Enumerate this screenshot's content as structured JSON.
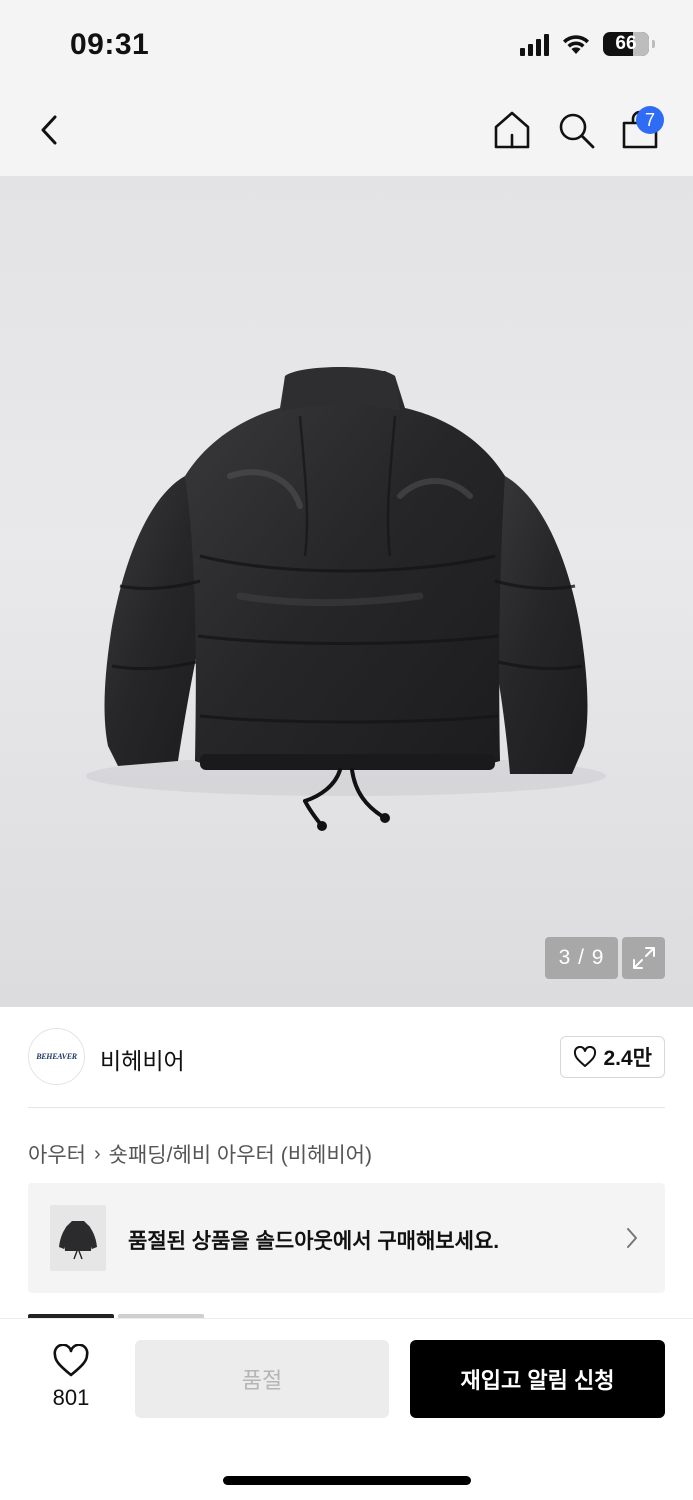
{
  "status_bar": {
    "time": "09:31",
    "battery_level": "66",
    "icons": [
      "cellular-signal-icon",
      "wifi-icon",
      "battery-icon"
    ]
  },
  "nav": {
    "icons": [
      "back-chevron-icon",
      "home-icon",
      "search-icon",
      "shopping-bag-icon"
    ],
    "cart_count": "7"
  },
  "product_image": {
    "counter": "3 / 9",
    "expand_icon": "expand-arrows-icon"
  },
  "brand": {
    "logo_text": "BEHEAVER",
    "name": "비헤비어",
    "like_count": "2.4만"
  },
  "breadcrumb": {
    "items": [
      "아우터",
      "숏패딩/헤비 아우터 (비헤비어)"
    ]
  },
  "soldout_banner": {
    "text": "품절된 상품을 솔드아웃에서 구매해보세요."
  },
  "bottom_bar": {
    "wish_count": "801",
    "soldout_label": "품절",
    "restock_label": "재입고 알림 신청"
  },
  "colors": {
    "accent_badge": "#2f6cf5",
    "primary_button": "#000000",
    "disabled_button": "#ececec"
  }
}
